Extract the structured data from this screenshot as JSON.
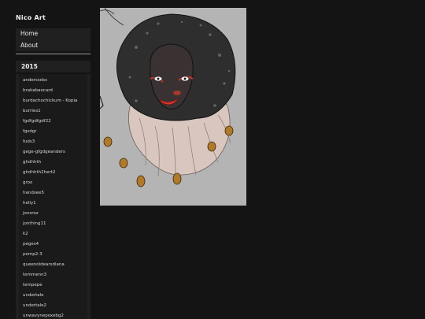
{
  "site": {
    "title": "Nico Art"
  },
  "nav": {
    "items": [
      {
        "label": "Home"
      },
      {
        "label": "About"
      }
    ]
  },
  "archive": {
    "year": "2015",
    "posts": [
      "anderssdss",
      "brakabaocard",
      "burdachochickum - Kopia",
      "burries1",
      "fgdfgdfgdf22",
      "fgsdgr",
      "fuds3",
      "gege-gfgdgeanders",
      "ghdhhth",
      "ghdhhth2hert2",
      "groo",
      "handsee5",
      "helly1",
      "jonsroz",
      "jonthing11",
      "k2",
      "peges4",
      "pomp2-3",
      "queenoldearsdiana",
      "temmenn3",
      "tempepe",
      "undertale",
      "undertale2",
      "unwavynepoxebg2"
    ]
  },
  "colors": {
    "background": "#141414",
    "panel": "#202020",
    "canvas": "#b2b2b2"
  }
}
